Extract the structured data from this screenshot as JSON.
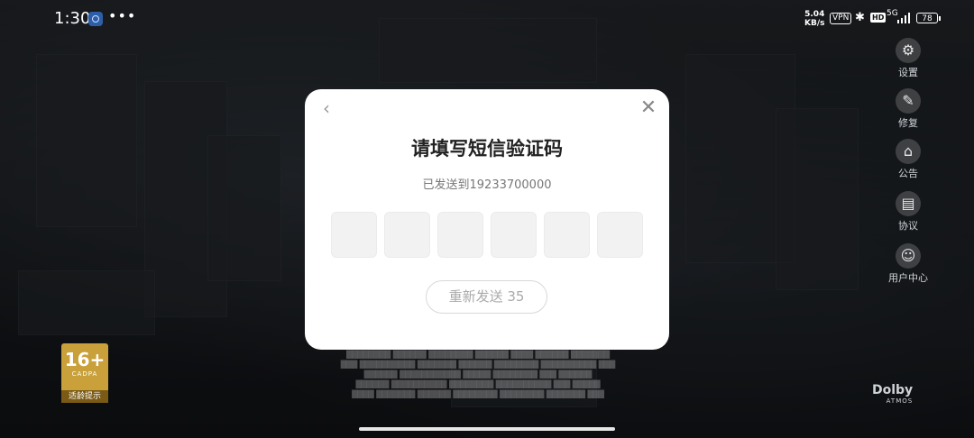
{
  "status_bar": {
    "time": "1:30",
    "more": "•••",
    "net_speed": "5.04",
    "net_unit": "KB/s",
    "vpn": "VPN",
    "bluetooth_icon": "bluetooth-icon",
    "hd": "HD",
    "signal": "5G",
    "battery": "78"
  },
  "side_menu": [
    {
      "label": "设置",
      "icon": "gear-icon"
    },
    {
      "label": "修复",
      "icon": "wrench-icon"
    },
    {
      "label": "公告",
      "icon": "announcement-icon"
    },
    {
      "label": "协议",
      "icon": "document-icon"
    },
    {
      "label": "用户中心",
      "icon": "user-icon"
    }
  ],
  "age_badge": {
    "number": "16+",
    "code": "CADPA",
    "label": "适龄提示"
  },
  "dolby": {
    "brand": "Dolby",
    "sub": "ATMOS"
  },
  "dialog": {
    "title": "请填写短信验证码",
    "sent_to": "已发送到19233700000",
    "resend": "重新发送 35",
    "code_length": 6
  }
}
